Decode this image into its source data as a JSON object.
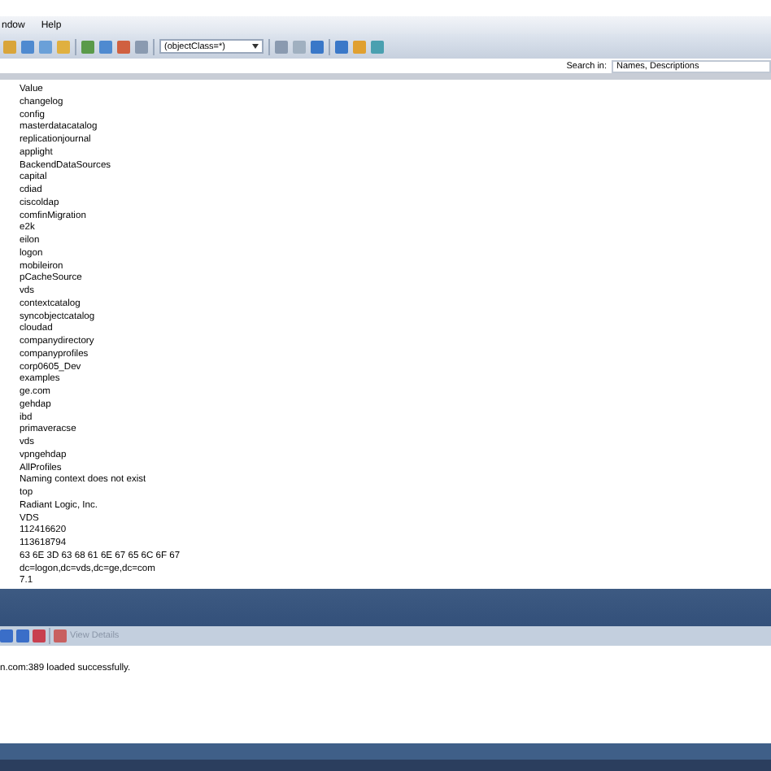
{
  "menu_bar": {
    "items": [
      "ndow",
      "Help"
    ]
  },
  "toolbar": {
    "filter": "(objectClass=*)"
  },
  "search": {
    "label": "Search in:",
    "value": "Names, Descriptions"
  },
  "list": {
    "header": "Value",
    "rows": [
      "changelog",
      "config",
      "masterdatacatalog",
      "replicationjournal",
      "applight",
      "BackendDataSources",
      "capital",
      "cdiad",
      "ciscoldap",
      "comfinMigration",
      "e2k",
      "eilon",
      "logon",
      "mobileiron",
      "pCacheSource",
      "vds",
      "contextcatalog",
      "syncobjectcatalog",
      "cloudad",
      "companydirectory",
      "companyprofiles",
      "corp0605_Dev",
      "examples",
      "ge.com",
      "gehdap",
      "ibd",
      "primaveracse",
      "vds",
      "vpngehdap",
      "AllProfiles",
      "Naming context does not exist",
      "top",
      "Radiant Logic, Inc.",
      "VDS",
      "112416620",
      "113618794",
      "63 6E 3D 63 68 61 6E 67 65 6C 6F 67",
      "dc=logon,dc=vds,dc=ge,dc=com",
      "7.1"
    ]
  },
  "log_toolbar": {
    "view_details": "View Details"
  },
  "log": {
    "message": "n.com:389 loaded successfully."
  }
}
